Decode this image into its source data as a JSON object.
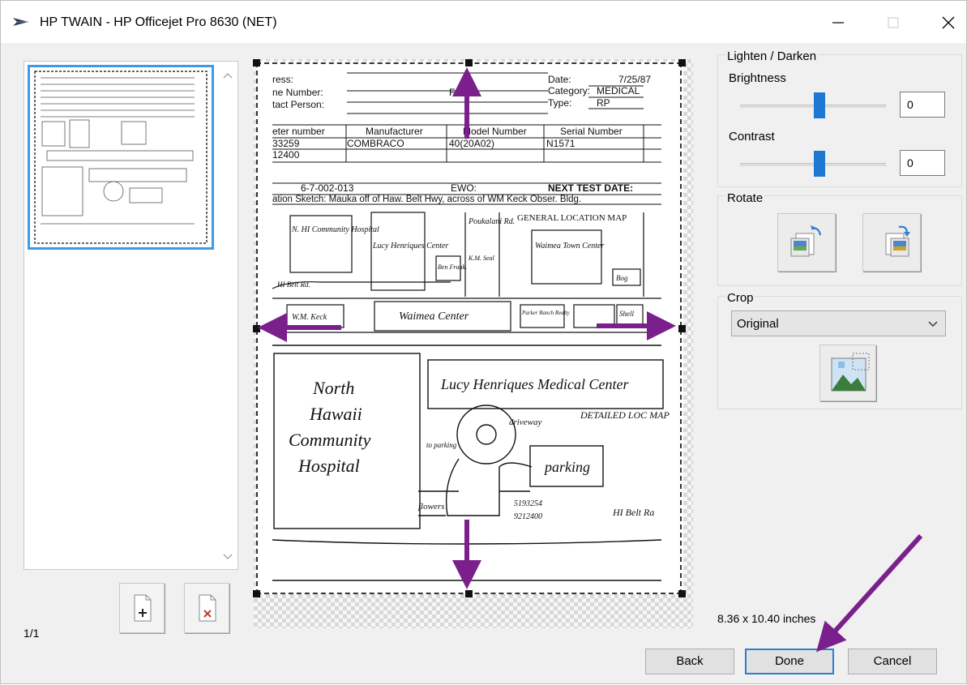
{
  "window": {
    "title": "HP TWAIN - HP Officejet Pro 8630 (NET)",
    "icon": "hp-scanner-icon"
  },
  "thumbnails": {
    "page_indicator": "1/1",
    "add_page_icon": "add-page-icon",
    "delete_page_icon": "delete-page-icon"
  },
  "preview": {
    "size_text": "8.36 x 10.40 inches",
    "document": {
      "header_lines": [
        "ress:",
        "ne Number:",
        "tact Person:"
      ],
      "date_label": "Date:",
      "date_value": "7/25/87",
      "category_label": "Category:",
      "category_value": "MEDICAL",
      "type_label": "Type:",
      "type_value": "RP",
      "fax_label": "Fa",
      "table_headers": [
        "eter number",
        "Manufacturer",
        "Model Number",
        "Serial Number"
      ],
      "table_row1": [
        "33259",
        "COMBRACO",
        "40(20A02)",
        "N1571"
      ],
      "table_row2": [
        "12400",
        "",
        "",
        ""
      ],
      "id_value": "6-7-002-013",
      "ewo_label": "EWO:",
      "next_test_label": "NEXT TEST DATE:",
      "sketch_line": "ation Sketch: Mauka off of Haw. Belt Hwy, across of WM Keck Obser. Bldg.",
      "map1": {
        "title": "GENERAL LOCATION MAP",
        "nhi": "N. HI Community Hospital",
        "lucy": "Lucy Henriques Center",
        "poukalani": "Poukalani Rd.",
        "waimea_town": "Waimea Town Center",
        "waimea_center": "Waimea Center",
        "wm_keck": "W.M. Keck",
        "ben": "Ben Frank.",
        "km": "K.M. Seal",
        "bog": "Bog",
        "parker": "Parker Ranch Realty",
        "shell": "Shell",
        "hi_belt": "HI Belt Rd."
      },
      "map2": {
        "title": "DETAILED LOC MAP",
        "nhch": [
          "North",
          "Hawaii",
          "Community",
          "Hospital"
        ],
        "lucy": "Lucy Henriques Medical Center",
        "driveway": "driveway",
        "to_parking": "to parking",
        "parking": "parking",
        "flowers": "flowers",
        "meter1": "5193254",
        "meter2": "9212400",
        "hi_belt": "HI Belt Ra"
      }
    }
  },
  "adjust": {
    "lighten_darken_label": "Lighten / Darken",
    "brightness_label": "Brightness",
    "brightness_value": "0",
    "contrast_label": "Contrast",
    "contrast_value": "0",
    "brightness_level": 0.5,
    "contrast_level": 0.5
  },
  "rotate": {
    "label": "Rotate",
    "rotate_left_icon": "rotate-left-icon",
    "rotate_right_icon": "rotate-right-icon"
  },
  "crop": {
    "label": "Crop",
    "selected": "Original",
    "crop_icon": "crop-image-icon"
  },
  "buttons": {
    "back": "Back",
    "done": "Done",
    "cancel": "Cancel"
  },
  "colors": {
    "accent": "#3c9be8",
    "slider": "#1e77d2",
    "annotation_arrow": "#7b1f8c"
  }
}
